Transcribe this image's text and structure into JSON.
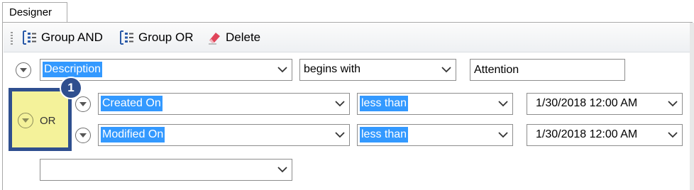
{
  "tabs": [
    {
      "label": "Designer"
    }
  ],
  "toolbar": {
    "group_and_label": "Group AND",
    "group_or_label": "Group OR",
    "delete_label": "Delete"
  },
  "conditions": [
    {
      "field": "Description",
      "operator": "begins with",
      "value": "Attention"
    },
    {
      "field": "Created On",
      "operator": "less than",
      "value": "1/30/2018 12:00 AM"
    },
    {
      "field": "Modified On",
      "operator": "less than",
      "value": "1/30/2018 12:00 AM"
    }
  ],
  "group": {
    "label": "OR",
    "callout_number": "1"
  },
  "new_field": {
    "value": ""
  },
  "colors": {
    "selection": "#3399ff",
    "group_highlight": "#f4f29a",
    "callout": "#2f4f8f"
  }
}
